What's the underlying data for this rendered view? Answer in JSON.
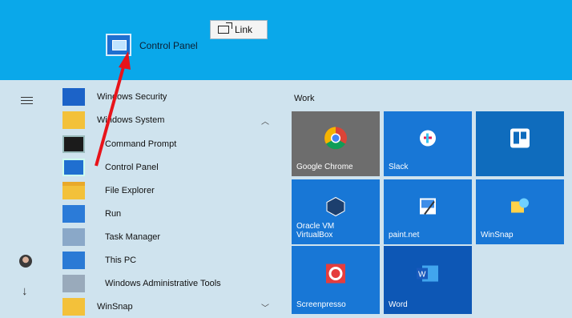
{
  "drag": {
    "label": "Control Panel",
    "tooltip": "Link"
  },
  "apps": [
    {
      "label": "Windows Security",
      "icon": "shield-icon",
      "indent": false,
      "chevron": ""
    },
    {
      "label": "Windows System",
      "icon": "folder-icon",
      "indent": false,
      "chevron": "^"
    },
    {
      "label": "Command Prompt",
      "icon": "terminal-icon",
      "indent": true,
      "chevron": ""
    },
    {
      "label": "Control Panel",
      "icon": "control-panel-icon",
      "indent": true,
      "chevron": ""
    },
    {
      "label": "File Explorer",
      "icon": "folder-open-icon",
      "indent": true,
      "chevron": ""
    },
    {
      "label": "Run",
      "icon": "run-icon",
      "indent": true,
      "chevron": ""
    },
    {
      "label": "Task Manager",
      "icon": "task-manager-icon",
      "indent": true,
      "chevron": ""
    },
    {
      "label": "This PC",
      "icon": "computer-icon",
      "indent": true,
      "chevron": ""
    },
    {
      "label": "Windows Administrative Tools",
      "icon": "admin-tools-icon",
      "indent": true,
      "chevron": ""
    },
    {
      "label": "WinSnap",
      "icon": "folder-icon",
      "indent": false,
      "chevron": "v"
    }
  ],
  "tiles_group": "Work",
  "tiles": [
    {
      "label": "Google Chrome",
      "icon": "chrome-icon",
      "bg": "#6d6d6d"
    },
    {
      "label": "Slack",
      "icon": "slack-icon",
      "bg": "#1877d6"
    },
    {
      "label": "",
      "icon": "trello-icon",
      "bg": "#0f6cbd"
    },
    {
      "label": "Oracle VM\nVirtualBox",
      "icon": "virtualbox-icon",
      "bg": "#1877d6"
    },
    {
      "label": "paint.net",
      "icon": "paintnet-icon",
      "bg": "#1877d6"
    },
    {
      "label": "WinSnap",
      "icon": "winsnap-icon",
      "bg": "#1877d6"
    },
    {
      "label": "Screenpresso",
      "icon": "screenpresso-icon",
      "bg": "#1877d6"
    },
    {
      "label": "Word",
      "icon": "word-icon",
      "bg": "#0d57b5"
    }
  ],
  "colors": {
    "desktop": "#0aa8ea",
    "startbg": "#cfe3ee",
    "tile": "#1877d6",
    "arrow": "#e8131a"
  }
}
